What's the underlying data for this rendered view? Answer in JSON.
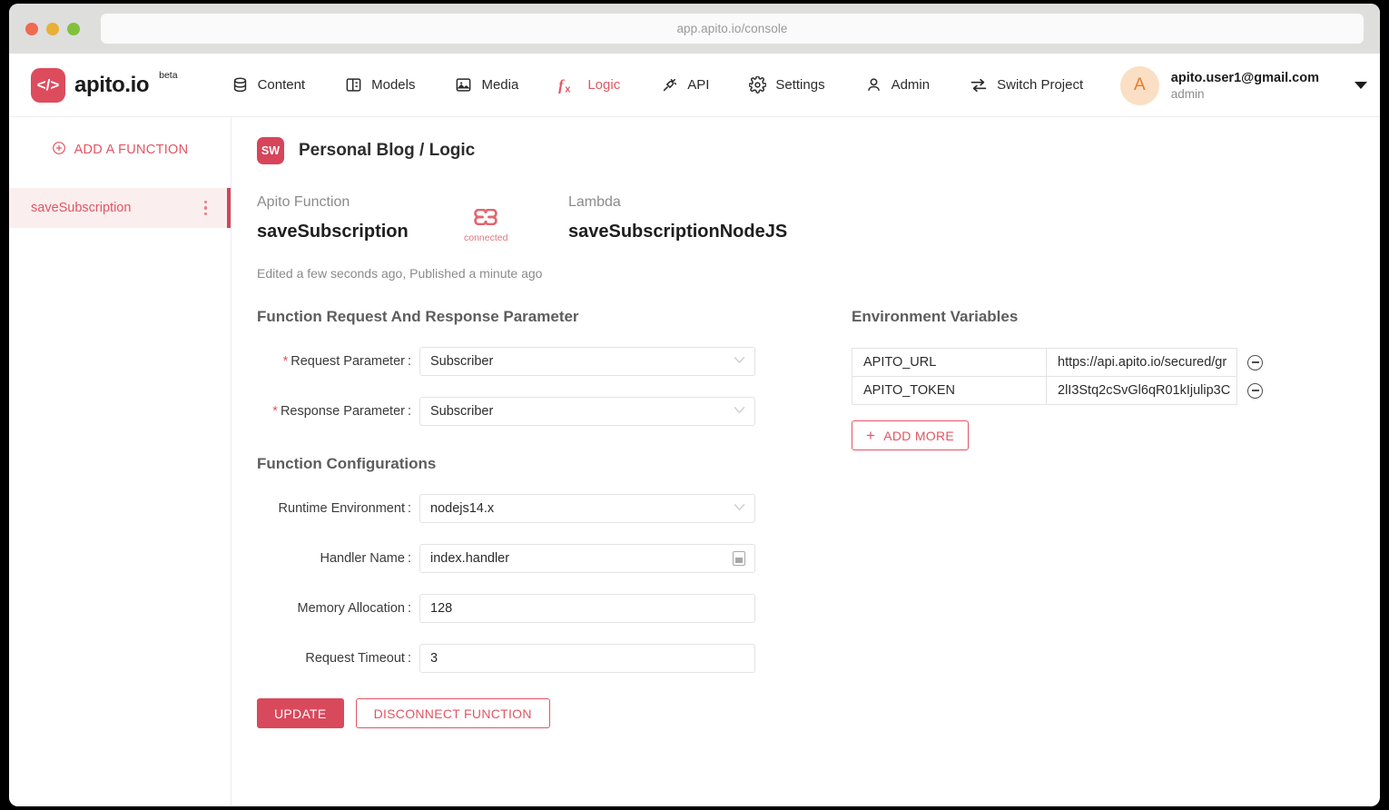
{
  "browser": {
    "url": "app.apito.io/console"
  },
  "brand": {
    "logo_glyph": "</>",
    "name": "apito.io",
    "beta": "beta"
  },
  "nav": {
    "items": [
      {
        "label": "Content",
        "icon": "database-icon",
        "active": false
      },
      {
        "label": "Models",
        "icon": "panels-icon",
        "active": false
      },
      {
        "label": "Media",
        "icon": "image-icon",
        "active": false
      },
      {
        "label": "Logic",
        "icon": "fx-icon",
        "active": true
      },
      {
        "label": "API",
        "icon": "plug-icon",
        "active": false
      },
      {
        "label": "Settings",
        "icon": "gear-icon",
        "active": false
      },
      {
        "label": "Admin",
        "icon": "user-icon",
        "active": false
      },
      {
        "label": "Switch Project",
        "icon": "swap-icon",
        "active": false
      }
    ]
  },
  "account": {
    "avatar_initial": "A",
    "email": "apito.user1@gmail.com",
    "role": "admin"
  },
  "sidebar": {
    "add_function_label": "ADD A FUNCTION",
    "functions": [
      {
        "name": "saveSubscription",
        "active": true
      }
    ]
  },
  "breadcrumb": {
    "badge": "SW",
    "text": "Personal Blog /  Logic"
  },
  "function_header": {
    "apito_caption": "Apito Function",
    "apito_name": "saveSubscription",
    "link_status": "connected",
    "lambda_caption": "Lambda",
    "lambda_name": "saveSubscriptionNodeJS",
    "edited_status": "Edited a few seconds ago, Published a minute ago"
  },
  "request_response": {
    "title": "Function Request And Response Parameter",
    "fields": [
      {
        "label": "Request Parameter",
        "required": true,
        "value": "Subscriber",
        "type": "select"
      },
      {
        "label": "Response Parameter",
        "required": true,
        "value": "Subscriber",
        "type": "select"
      }
    ]
  },
  "configurations": {
    "title": "Function Configurations",
    "fields": [
      {
        "label": "Runtime Environment",
        "required": false,
        "value": "nodejs14.x",
        "type": "select"
      },
      {
        "label": "Handler Name",
        "required": false,
        "value": "index.handler",
        "type": "text-icon"
      },
      {
        "label": "Memory Allocation",
        "required": false,
        "value": "128",
        "type": "text"
      },
      {
        "label": "Request Timeout",
        "required": false,
        "value": "3",
        "type": "text"
      }
    ],
    "update_label": "UPDATE",
    "disconnect_label": "DISCONNECT FUNCTION"
  },
  "environment": {
    "title": "Environment Variables",
    "variables": [
      {
        "key": "APITO_URL",
        "value": "https://api.apito.io/secured/gr"
      },
      {
        "key": "APITO_TOKEN",
        "value": "2lI3Stq2cSvGl6qR01kIjulip3C"
      }
    ],
    "add_more_label": "ADD MORE"
  },
  "colors": {
    "accent_red": "#e25563",
    "primary_button": "#d9495c",
    "badge_red": "#d7455a",
    "avatar_bg": "#fbdfc4",
    "avatar_fg": "#e87a2a"
  }
}
